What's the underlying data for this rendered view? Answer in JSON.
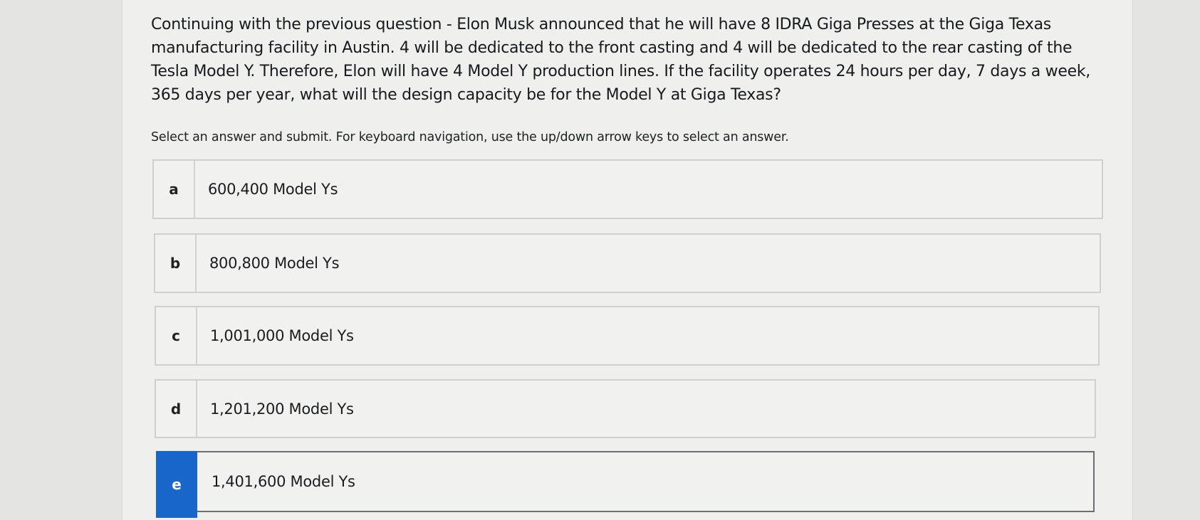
{
  "question": {
    "text": "Continuing with the previous question - Elon Musk announced that he will have 8 IDRA Giga Presses at the Giga Texas manufacturing facility in Austin.  4 will be dedicated to the front casting and 4 will be dedicated to the rear casting of the Tesla Model Y.  Therefore, Elon will have 4 Model Y production lines.  If the facility operates 24 hours per day, 7 days a week, 365 days per year, what will the design capacity be for the Model Y at Giga Texas?"
  },
  "instruction": "Select an answer and submit. For keyboard navigation, use the up/down arrow keys to select an answer.",
  "options": [
    {
      "letter": "a",
      "text": "600,400 Model Ys",
      "selected": false
    },
    {
      "letter": "b",
      "text": "800,800 Model Ys",
      "selected": false
    },
    {
      "letter": "c",
      "text": "1,001,000 Model Ys",
      "selected": false
    },
    {
      "letter": "d",
      "text": "1,201,200 Model Ys",
      "selected": false
    },
    {
      "letter": "e",
      "text": "1,401,600 Model Ys",
      "selected": true
    }
  ],
  "colors": {
    "selected_accent": "#1866c9",
    "background": "#eff0ee",
    "border": "#cfd0cd"
  }
}
